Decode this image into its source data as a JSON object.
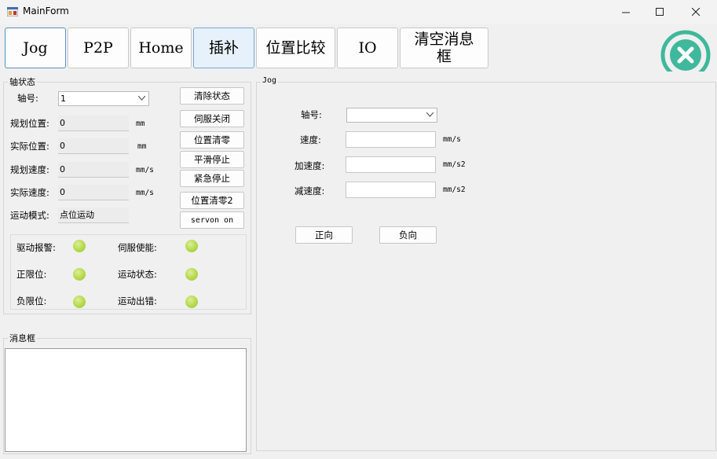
{
  "window": {
    "title": "MainForm",
    "minimize": "—",
    "maximize": "☐",
    "close": "✕"
  },
  "toolbar": {
    "tabs": [
      {
        "label": "Jog"
      },
      {
        "label": "P2P"
      },
      {
        "label": "Home"
      },
      {
        "label": "插补"
      },
      {
        "label": "位置比较"
      },
      {
        "label": "IO"
      },
      {
        "label": "清空消息框"
      }
    ],
    "exit_icon": "circle-x-icon",
    "exit_color": "#3fb89b"
  },
  "axis_status": {
    "group_label": "轴状态",
    "axis_label": "轴号:",
    "axis_value": "1",
    "rows": [
      {
        "label": "规划位置:",
        "value": "0",
        "unit": "mm"
      },
      {
        "label": "实际位置:",
        "value": "0",
        "unit": "mm"
      },
      {
        "label": "规划速度:",
        "value": "0",
        "unit": "mm/s"
      },
      {
        "label": "实际速度:",
        "value": "0",
        "unit": "mm/s"
      },
      {
        "label": "运动模式:",
        "value": "点位运动",
        "unit": ""
      }
    ],
    "buttons": [
      {
        "label": "清除状态"
      },
      {
        "label": "伺服关闭"
      },
      {
        "label": "位置清零"
      },
      {
        "label": "平滑停止"
      },
      {
        "label": "紧急停止"
      },
      {
        "label": "位置清零2"
      },
      {
        "label": "servon on"
      }
    ],
    "indicators": [
      {
        "label": "驱动报警:"
      },
      {
        "label": "伺服使能:"
      },
      {
        "label": "正限位:"
      },
      {
        "label": "运动状态:"
      },
      {
        "label": "负限位:"
      },
      {
        "label": "运动出错:"
      }
    ],
    "indicator_color": "#b5d94a"
  },
  "message_box": {
    "group_label": "消息框",
    "content": ""
  },
  "jog": {
    "group_label": "Jog",
    "axis_label": "轴号:",
    "axis_value": "",
    "fields": [
      {
        "label": "速度:",
        "value": "",
        "unit": "mm/s"
      },
      {
        "label": "加速度:",
        "value": "",
        "unit": "mm/s2"
      },
      {
        "label": "减速度:",
        "value": "",
        "unit": "mm/s2"
      }
    ],
    "forward_label": "正向",
    "reverse_label": "负向"
  }
}
